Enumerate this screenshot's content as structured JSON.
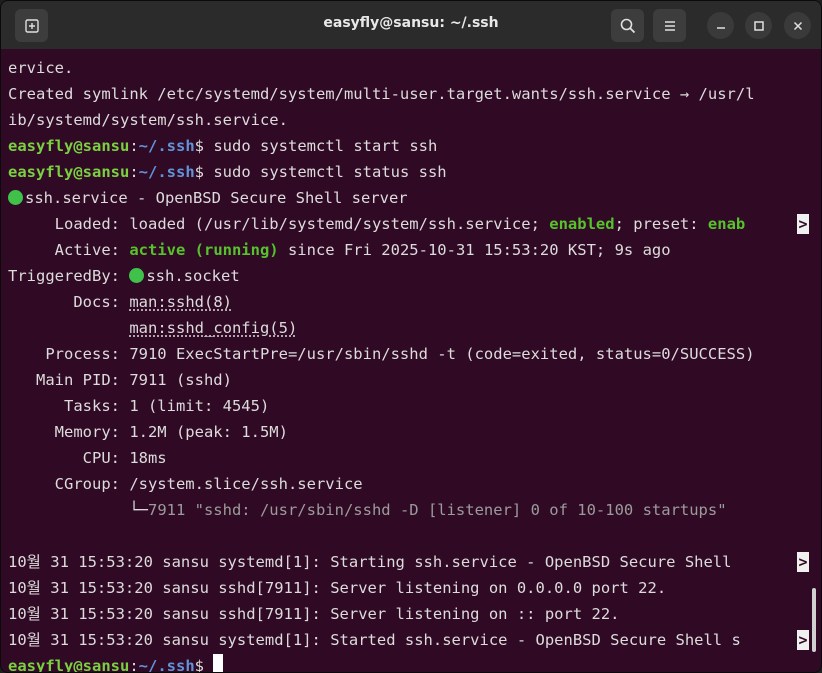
{
  "window": {
    "title": "easyfly@sansu: ~/.ssh"
  },
  "prompt": {
    "user": "easyfly@sansu",
    "sep": ":",
    "path": "~/.ssh",
    "dollar": "$"
  },
  "lines": {
    "l0": "ervice.",
    "l1": "Created symlink /etc/systemd/system/multi-user.target.wants/ssh.service → /usr/l",
    "l2": "ib/systemd/system/ssh.service.",
    "cmd1": " sudo systemctl start ssh",
    "cmd2": " sudo systemctl status ssh",
    "svc": "ssh.service - OpenBSD Secure Shell server",
    "loaded_label": "     Loaded: ",
    "loaded_a": "loaded (/usr/lib/systemd/system/ssh.service; ",
    "loaded_enabled": "enabled",
    "loaded_b": "; preset: ",
    "loaded_enab": "enab",
    "active_label": "     Active: ",
    "active_state": "active (running)",
    "active_rest": " since Fri 2025-10-31 15:53:20 KST; 9s ago",
    "triggered_label": "TriggeredBy: ",
    "triggered_val": "ssh.socket",
    "docs_label": "       Docs: ",
    "docs1": "man:sshd(8)",
    "docs2": "man:sshd_config(5)",
    "process": "    Process: 7910 ExecStartPre=/usr/sbin/sshd -t (code=exited, status=0/SUCCESS)",
    "mainpid": "   Main PID: 7911 (sshd)",
    "tasks": "      Tasks: 1 (limit: 4545)",
    "memory": "     Memory: 1.2M (peak: 1.5M)",
    "cpu": "        CPU: 18ms",
    "cgroup": "     CGroup: /system.slice/ssh.service",
    "tree": "             └─",
    "tree_proc": "7911 \"sshd: /usr/sbin/sshd -D [listener] 0 of 10-100 startups\"",
    "log1": "10월 31 15:53:20 sansu systemd[1]: Starting ssh.service - OpenBSD Secure Shell ",
    "log2": "10월 31 15:53:20 sansu sshd[7911]: Server listening on 0.0.0.0 port 22.",
    "log3": "10월 31 15:53:20 sansu sshd[7911]: Server listening on :: port 22.",
    "log4": "10월 31 15:53:20 sansu systemd[1]: Started ssh.service - OpenBSD Secure Shell s",
    "trunc": ">"
  },
  "icons": {
    "new_tab": "new-tab-icon",
    "search": "search-icon",
    "menu": "hamburger-menu-icon",
    "minimize": "minimize-icon",
    "maximize": "maximize-icon",
    "close": "close-icon"
  },
  "colors": {
    "background": "#300a24",
    "user": "#7bd041",
    "path": "#6193d9",
    "status_green": "#56c22c"
  }
}
